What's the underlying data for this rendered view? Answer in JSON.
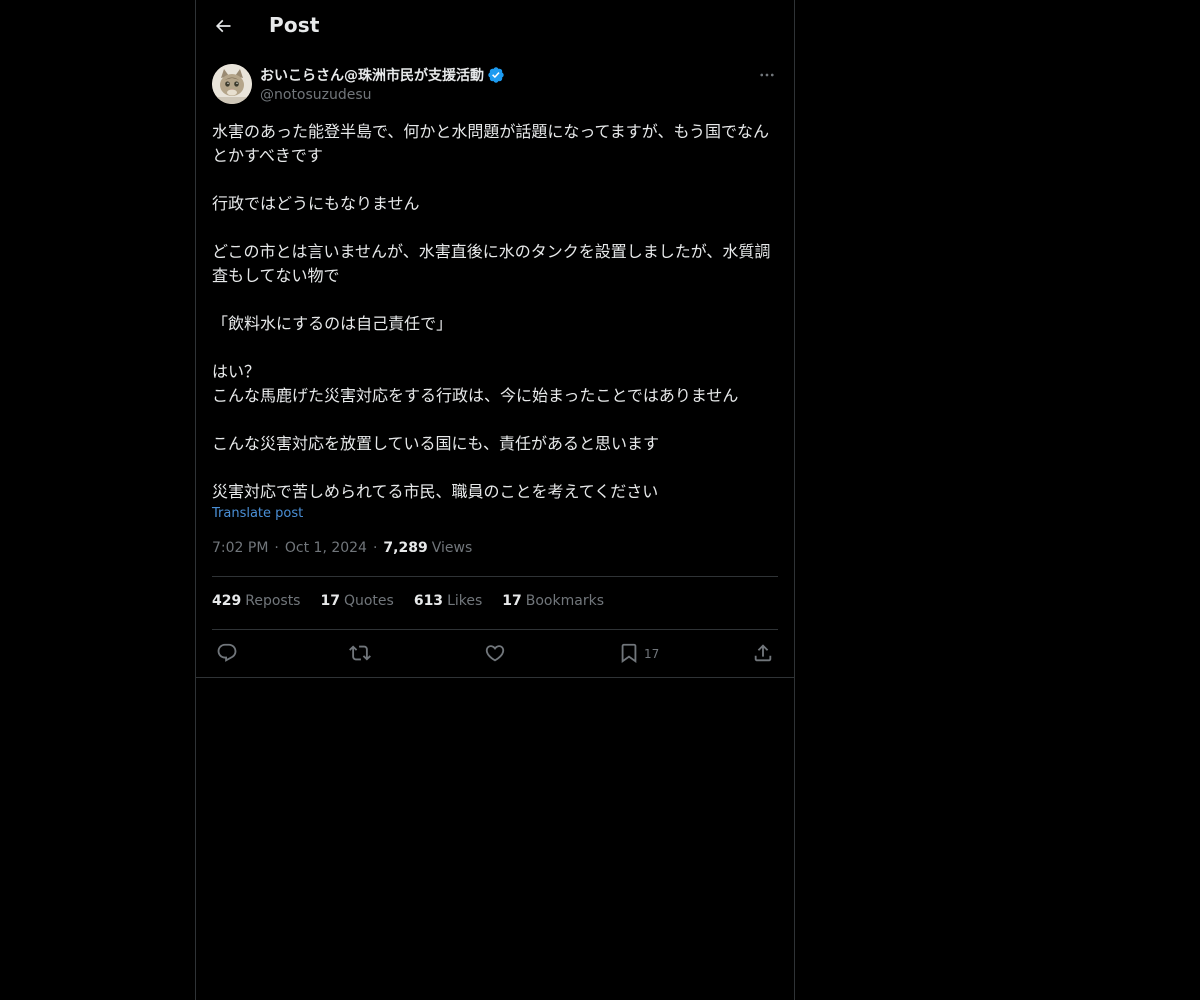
{
  "header": {
    "title": "Post",
    "back_icon": "arrow-left-icon"
  },
  "author": {
    "display_name": "おいこらさん@珠洲市民が支援活動",
    "handle": "@notosuzudesu",
    "verified": true,
    "verified_color": "#1d9bf0"
  },
  "post": {
    "text": "水害のあった能登半島で、何かと水問題が話題になってますが、もう国でなんとかすべきです\n\n行政ではどうにもなりません\n\nどこの市とは言いませんが、水害直後に水のタンクを設置しましたが、水質調査もしてない物で\n\n「飲料水にするのは自己責任で」\n\nはい？\nこんな馬鹿げた災害対応をする行政は、今に始まったことではありません\n\nこんな災害対応を放置している国にも、責任があると思います\n\n災害対応で苦しめられてる市民、職員のことを考えてください",
    "translate_label": "Translate post",
    "time": "7:02 PM",
    "separator": "·",
    "date": "Oct 1, 2024",
    "views_count": "7,289",
    "views_label": "Views"
  },
  "stats": {
    "reposts": {
      "count": "429",
      "label": "Reposts"
    },
    "quotes": {
      "count": "17",
      "label": "Quotes"
    },
    "likes": {
      "count": "613",
      "label": "Likes"
    },
    "bookmarks": {
      "count": "17",
      "label": "Bookmarks"
    }
  },
  "actions": {
    "bookmark_count": "17"
  },
  "colors": {
    "background": "#000000",
    "text": "#e7e9ea",
    "secondary": "#71767b",
    "border": "#2f3336",
    "link": "#4a8fd6"
  }
}
